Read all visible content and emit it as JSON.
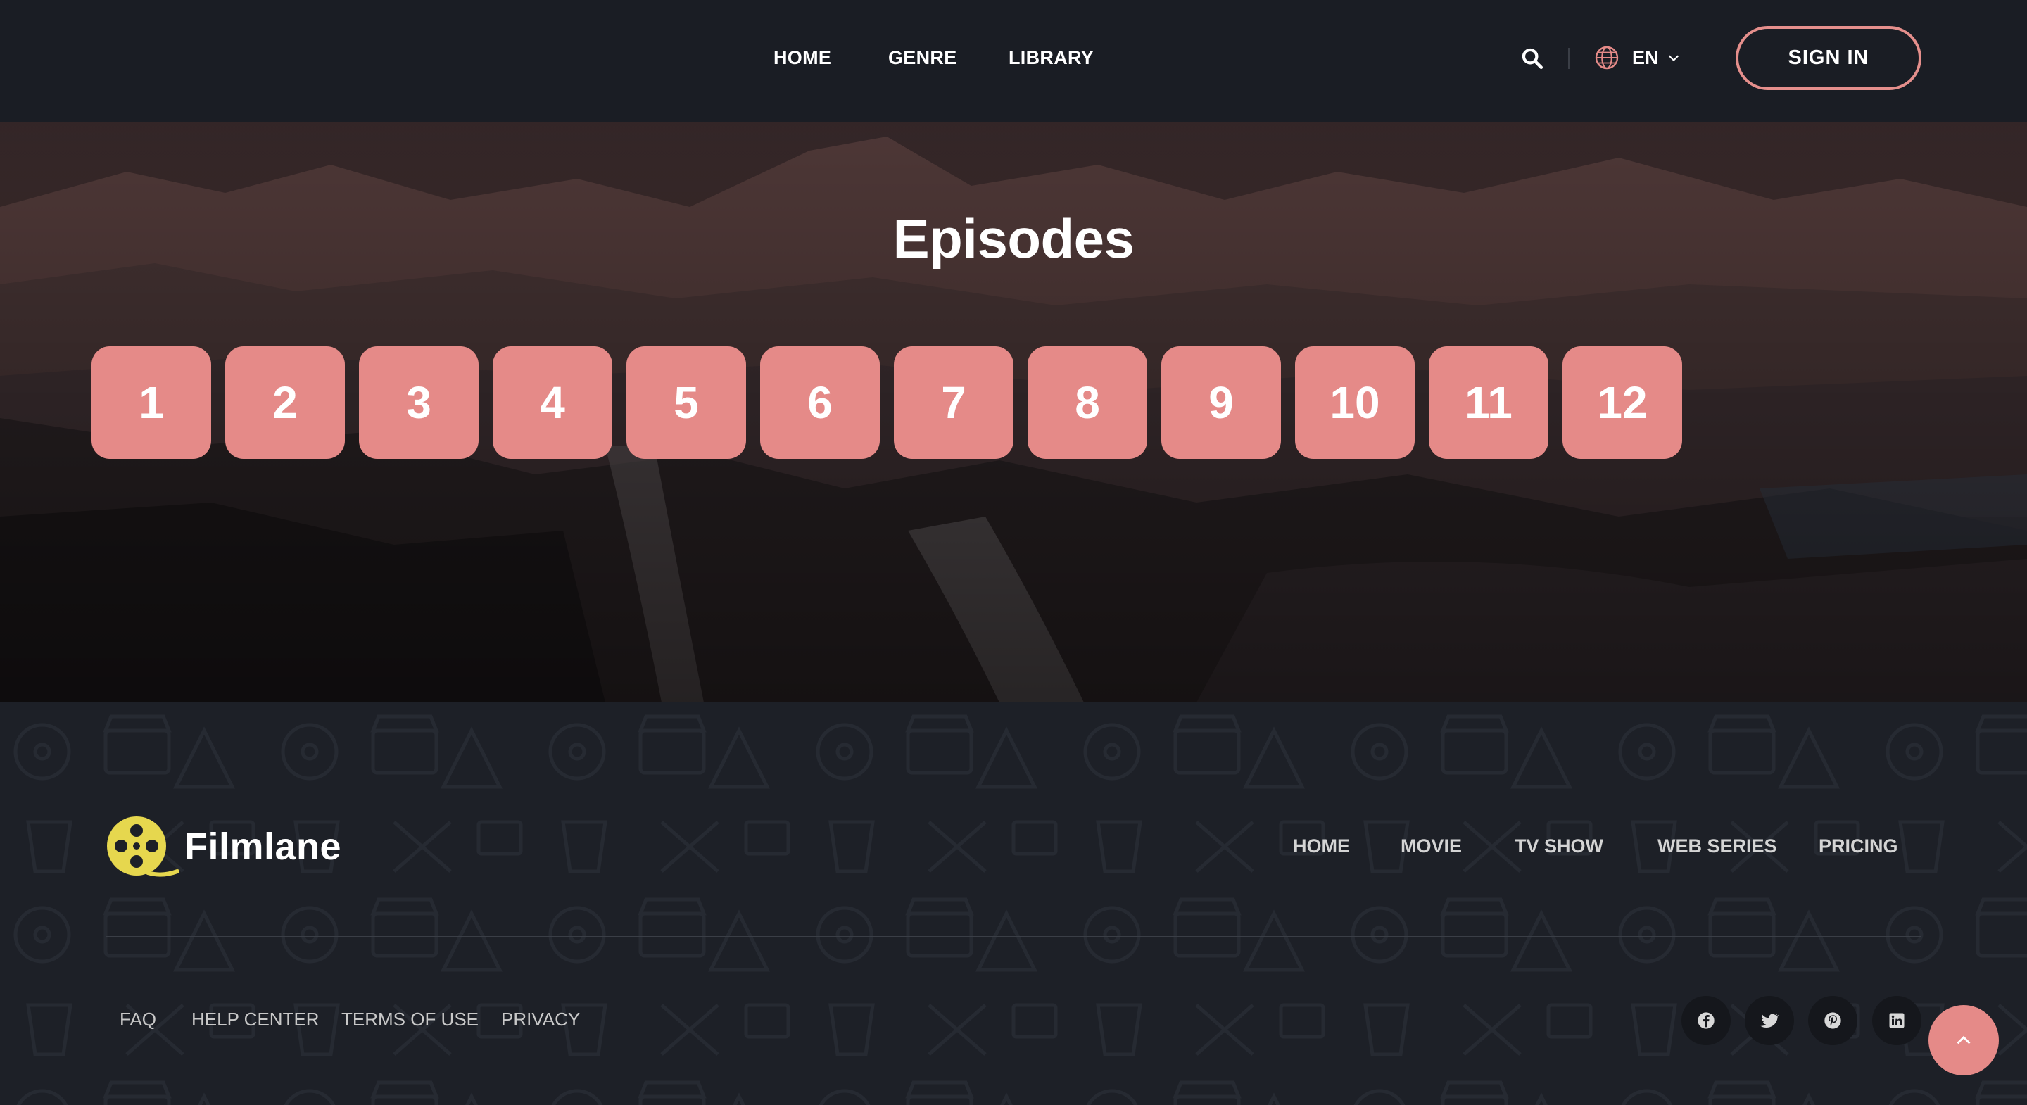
{
  "header": {
    "nav": [
      {
        "label": "HOME"
      },
      {
        "label": "GENRE"
      },
      {
        "label": "LIBRARY"
      }
    ],
    "search_icon": "search-icon",
    "language": {
      "code": "EN",
      "icon": "globe-icon"
    },
    "signin_label": "SIGN IN"
  },
  "hero": {
    "title": "Episodes",
    "episodes": [
      "1",
      "2",
      "3",
      "4",
      "5",
      "6",
      "7",
      "8",
      "9",
      "10",
      "11",
      "12"
    ]
  },
  "footer": {
    "brand": {
      "name": "Filmlane",
      "icon": "film-reel-icon"
    },
    "nav": [
      {
        "label": "HOME"
      },
      {
        "label": "MOVIE"
      },
      {
        "label": "TV SHOW"
      },
      {
        "label": "WEB SERIES"
      },
      {
        "label": "PRICING"
      }
    ],
    "links": [
      {
        "label": "FAQ"
      },
      {
        "label": "HELP CENTER"
      },
      {
        "label": "TERMS OF USE"
      },
      {
        "label": "PRIVACY"
      }
    ],
    "social": [
      "facebook-icon",
      "twitter-icon",
      "pinterest-icon",
      "linkedin-icon"
    ],
    "back_to_top_icon": "chevron-up-icon"
  },
  "colors": {
    "accent": "#e58a88",
    "logo_yellow": "#e6d74e",
    "header_bg": "#1a1d24",
    "footer_bg": "#1d2027"
  }
}
